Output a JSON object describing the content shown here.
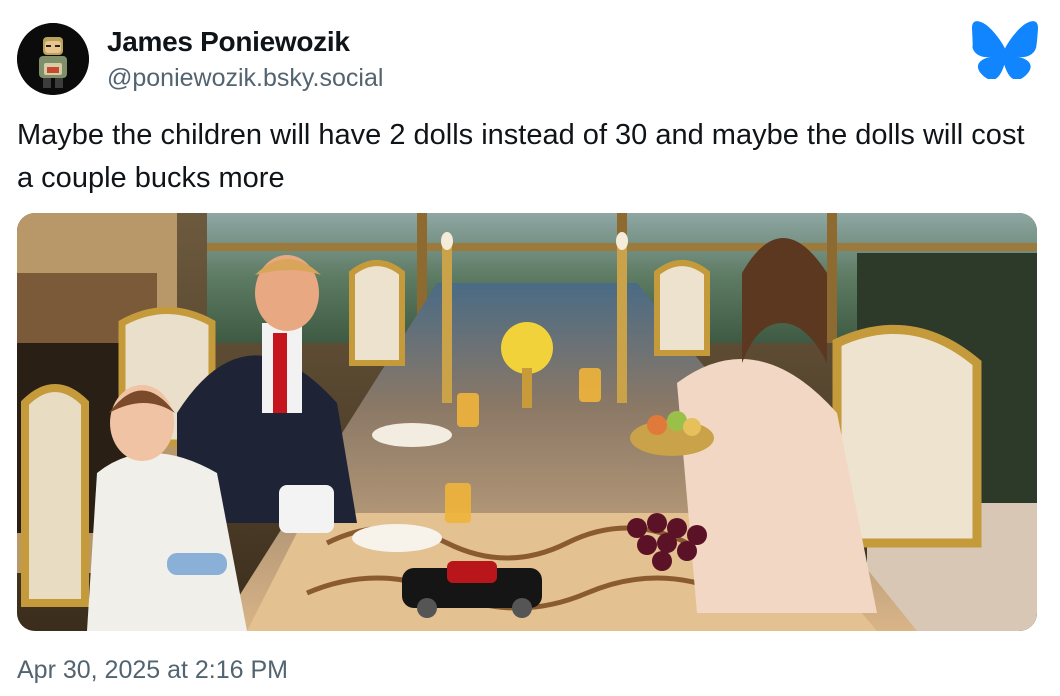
{
  "author": {
    "display_name": "James Poniewozik",
    "handle": "@poniewozik.bsky.social",
    "avatar_icon": "avatar-figure-icon"
  },
  "brand": {
    "icon": "bluesky-butterfly-icon",
    "color": "#1185fe"
  },
  "post": {
    "text": "Maybe the children will have 2 dolls instead of 30 and maybe the dolls will cost a couple bucks more",
    "timestamp": "Apr 30, 2025 at 2:16 PM"
  },
  "media": {
    "type": "photo",
    "alt": ""
  },
  "colors": {
    "text_primary": "#0f1419",
    "text_secondary": "#536471",
    "background": "#ffffff"
  }
}
